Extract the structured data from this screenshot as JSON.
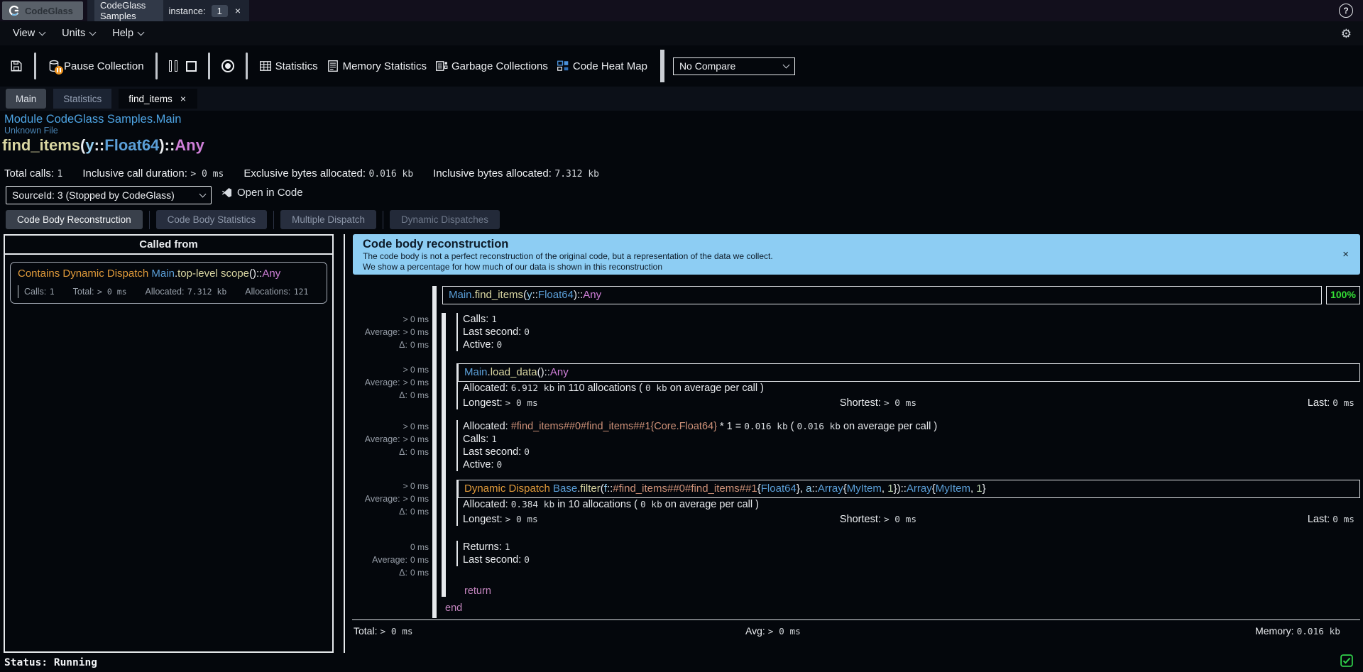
{
  "colors": {
    "banner_blue": "#8dcdf3",
    "coverage_green": "#35e035",
    "dispatch_orange": "#e09a3a",
    "function_cream": "#d9d6a2",
    "type_blue": "#5b9fd8",
    "any_magenta": "#cf7fd8",
    "breadcrumb_blue": "#4da3e2",
    "status_check_green": "#31d24b",
    "pause_badge_orange": "#ee9421"
  },
  "icons": {
    "close": "×",
    "help": "?",
    "gear": "⚙"
  },
  "titlebar": {
    "app_name": "CodeGlass",
    "instance_tab": {
      "label": "CodeGlass Samples",
      "instance_label": "instance:",
      "instance_value": "1"
    }
  },
  "menubar": {
    "items": [
      {
        "label": "View"
      },
      {
        "label": "Units"
      },
      {
        "label": "Help"
      }
    ]
  },
  "toolbar": {
    "pause_collection_label": "Pause Collection",
    "statistics_label": "Statistics",
    "memory_statistics_label": "Memory Statistics",
    "garbage_collections_label": "Garbage Collections",
    "code_heat_map_label": "Code Heat Map",
    "compare_select_value": "No Compare"
  },
  "doc_tabs": {
    "main": "Main",
    "statistics": "Statistics",
    "find_items": "find_items"
  },
  "breadcrumb": {
    "module": "Module CodeGlass Samples.Main",
    "file": "Unknown File"
  },
  "headline_tokens": [
    {
      "t": "find_items",
      "c": "fn"
    },
    {
      "t": "(",
      "c": "plain"
    },
    {
      "t": "y",
      "c": "var"
    },
    {
      "t": "::",
      "c": "plain"
    },
    {
      "t": "Float64",
      "c": "type"
    },
    {
      "t": ")::",
      "c": "plain"
    },
    {
      "t": "Any",
      "c": "any"
    }
  ],
  "summary": {
    "items": [
      {
        "label": "Total calls:",
        "value": "1"
      },
      {
        "label": "Inclusive call duration:",
        "value": "> 0 ms"
      },
      {
        "label": "Exclusive bytes allocated:",
        "value": "0.016 kb"
      },
      {
        "label": "Inclusive bytes allocated:",
        "value": "7.312 kb"
      }
    ]
  },
  "source_row": {
    "select_value": "SourceId: 3 (Stopped by CodeGlass)",
    "open_in_code": "Open in Code"
  },
  "sub_tabs": {
    "reconstruction": "Code Body Reconstruction",
    "statistics": "Code Body Statistics",
    "multiple_dispatch": "Multiple Dispatch",
    "dynamic_dispatches": "Dynamic Dispatches"
  },
  "called_from": {
    "header": "Called from",
    "item": {
      "tokens": [
        {
          "t": "Contains Dynamic Dispatch ",
          "c": "orange"
        },
        {
          "t": "Main",
          "c": "type"
        },
        {
          "t": ".",
          "c": "plain"
        },
        {
          "t": "top-level scope",
          "c": "fn"
        },
        {
          "t": "()::",
          "c": "plain"
        },
        {
          "t": "Any",
          "c": "any"
        }
      ],
      "stats": [
        {
          "label": "Calls:",
          "value": "1"
        },
        {
          "label": "Total:",
          "value": "> 0 ms"
        },
        {
          "label": "Allocated:",
          "value": "7.312 kb"
        },
        {
          "label": "Allocations:",
          "value": "121"
        }
      ]
    }
  },
  "banner": {
    "title": "Code body reconstruction",
    "line1": "The code body is not a perfect reconstruction of the original code, but a representation of the data we collect.",
    "line2": "We show a percentage for how much of our data is shown in this reconstruction"
  },
  "code": {
    "coverage": "100%",
    "sig_tokens": [
      {
        "t": "Main",
        "c": "type"
      },
      {
        "t": ".",
        "c": "plain"
      },
      {
        "t": "find_items",
        "c": "fn"
      },
      {
        "t": "(",
        "c": "plain"
      },
      {
        "t": "y",
        "c": "var"
      },
      {
        "t": "::",
        "c": "plain"
      },
      {
        "t": "Float64",
        "c": "type"
      },
      {
        "t": ")::",
        "c": "plain"
      },
      {
        "t": "Any",
        "c": "any"
      }
    ],
    "gutter_labels": {
      "avg": "Average:",
      "delta": "Δ:"
    },
    "gutters": {
      "g1": {
        "time": "> 0 ms",
        "avg": "> 0 ms",
        "delta": "0 ms"
      },
      "g2": {
        "time": "> 0 ms",
        "avg": "> 0 ms",
        "delta": "0 ms"
      },
      "g3": {
        "time": "> 0 ms",
        "avg": "> 0 ms",
        "delta": "0 ms"
      },
      "g4": {
        "time": "> 0 ms",
        "avg": "> 0 ms",
        "delta": "0 ms"
      },
      "g5": {
        "time": "0 ms",
        "avg": "0 ms",
        "delta": "0 ms"
      }
    },
    "blocks": {
      "top_stats": {
        "calls": {
          "label": "Calls:",
          "value": "1"
        },
        "last": {
          "label": "Last second:",
          "value": "0"
        },
        "active": {
          "label": "Active:",
          "value": "0"
        }
      },
      "load_data": {
        "sig_tokens": [
          {
            "t": "Main",
            "c": "type"
          },
          {
            "t": ".",
            "c": "plain"
          },
          {
            "t": "load_data",
            "c": "fn"
          },
          {
            "t": "()::",
            "c": "plain"
          },
          {
            "t": "Any",
            "c": "any"
          }
        ],
        "alloc_tokens": [
          {
            "t": "Allocated: ",
            "c": "plain"
          },
          {
            "t": "6.912 kb",
            "c": "mono"
          },
          {
            "t": " in 110 allocations ( ",
            "c": "plain"
          },
          {
            "t": "0 kb",
            "c": "mono"
          },
          {
            "t": " on average per call )",
            "c": "plain"
          }
        ],
        "longest": {
          "label": "Longest:",
          "value": "> 0 ms"
        },
        "shortest": {
          "label": "Shortest:",
          "value": "> 0 ms"
        },
        "last": {
          "label": "Last:",
          "value": "0 ms"
        }
      },
      "alloc": {
        "alloc_tokens": [
          {
            "t": "Allocated: ",
            "c": "plain"
          },
          {
            "t": "#find_items##0#find_items##1{Core.Float64}",
            "c": "tan"
          },
          {
            "t": " * 1 = ",
            "c": "plain"
          },
          {
            "t": "0.016 kb",
            "c": "mono"
          },
          {
            "t": " ( ",
            "c": "plain"
          },
          {
            "t": "0.016 kb",
            "c": "mono"
          },
          {
            "t": " on average per call )",
            "c": "plain"
          }
        ],
        "calls": {
          "label": "Calls:",
          "value": "1"
        },
        "last": {
          "label": "Last second:",
          "value": "0"
        },
        "active": {
          "label": "Active:",
          "value": "0"
        }
      },
      "dispatch": {
        "sig_tokens": [
          {
            "t": "Dynamic Dispatch ",
            "c": "orange"
          },
          {
            "t": "Base",
            "c": "type"
          },
          {
            "t": ".",
            "c": "plain"
          },
          {
            "t": "filter",
            "c": "fn"
          },
          {
            "t": "(",
            "c": "plain"
          },
          {
            "t": "f",
            "c": "var"
          },
          {
            "t": "::",
            "c": "plain"
          },
          {
            "t": "#find_items##0#find_items##1",
            "c": "tan"
          },
          {
            "t": "{",
            "c": "plain"
          },
          {
            "t": "Float64",
            "c": "type"
          },
          {
            "t": "}, ",
            "c": "plain"
          },
          {
            "t": "a",
            "c": "var"
          },
          {
            "t": "::",
            "c": "plain"
          },
          {
            "t": "Array",
            "c": "type"
          },
          {
            "t": "{",
            "c": "plain"
          },
          {
            "t": "MyItem",
            "c": "type"
          },
          {
            "t": ", ",
            "c": "plain"
          },
          {
            "t": "1",
            "c": "num"
          },
          {
            "t": "})::",
            "c": "plain"
          },
          {
            "t": "Array",
            "c": "type"
          },
          {
            "t": "{",
            "c": "plain"
          },
          {
            "t": "MyItem",
            "c": "type"
          },
          {
            "t": ", ",
            "c": "plain"
          },
          {
            "t": "1",
            "c": "num"
          },
          {
            "t": "}",
            "c": "plain"
          }
        ],
        "alloc_tokens": [
          {
            "t": "Allocated: ",
            "c": "plain"
          },
          {
            "t": "0.384 kb",
            "c": "mono"
          },
          {
            "t": " in 10 allocations ( ",
            "c": "plain"
          },
          {
            "t": "0 kb",
            "c": "mono"
          },
          {
            "t": " on average per call )",
            "c": "plain"
          }
        ],
        "longest": {
          "label": "Longest:",
          "value": "> 0 ms"
        },
        "shortest": {
          "label": "Shortest:",
          "value": "> 0 ms"
        },
        "last": {
          "label": "Last:",
          "value": "0 ms"
        }
      },
      "returns": {
        "returns": {
          "label": "Returns:",
          "value": "1"
        },
        "last": {
          "label": "Last second:",
          "value": "0"
        }
      }
    },
    "return_keyword": "return",
    "end_keyword": "end"
  },
  "totals": {
    "total": {
      "label": "Total:",
      "value": "> 0 ms"
    },
    "avg": {
      "label": "Avg:",
      "value": "> 0 ms"
    },
    "memory": {
      "label": "Memory:",
      "value": "0.016 kb"
    }
  },
  "statusbar": {
    "text": "Status: Running"
  }
}
